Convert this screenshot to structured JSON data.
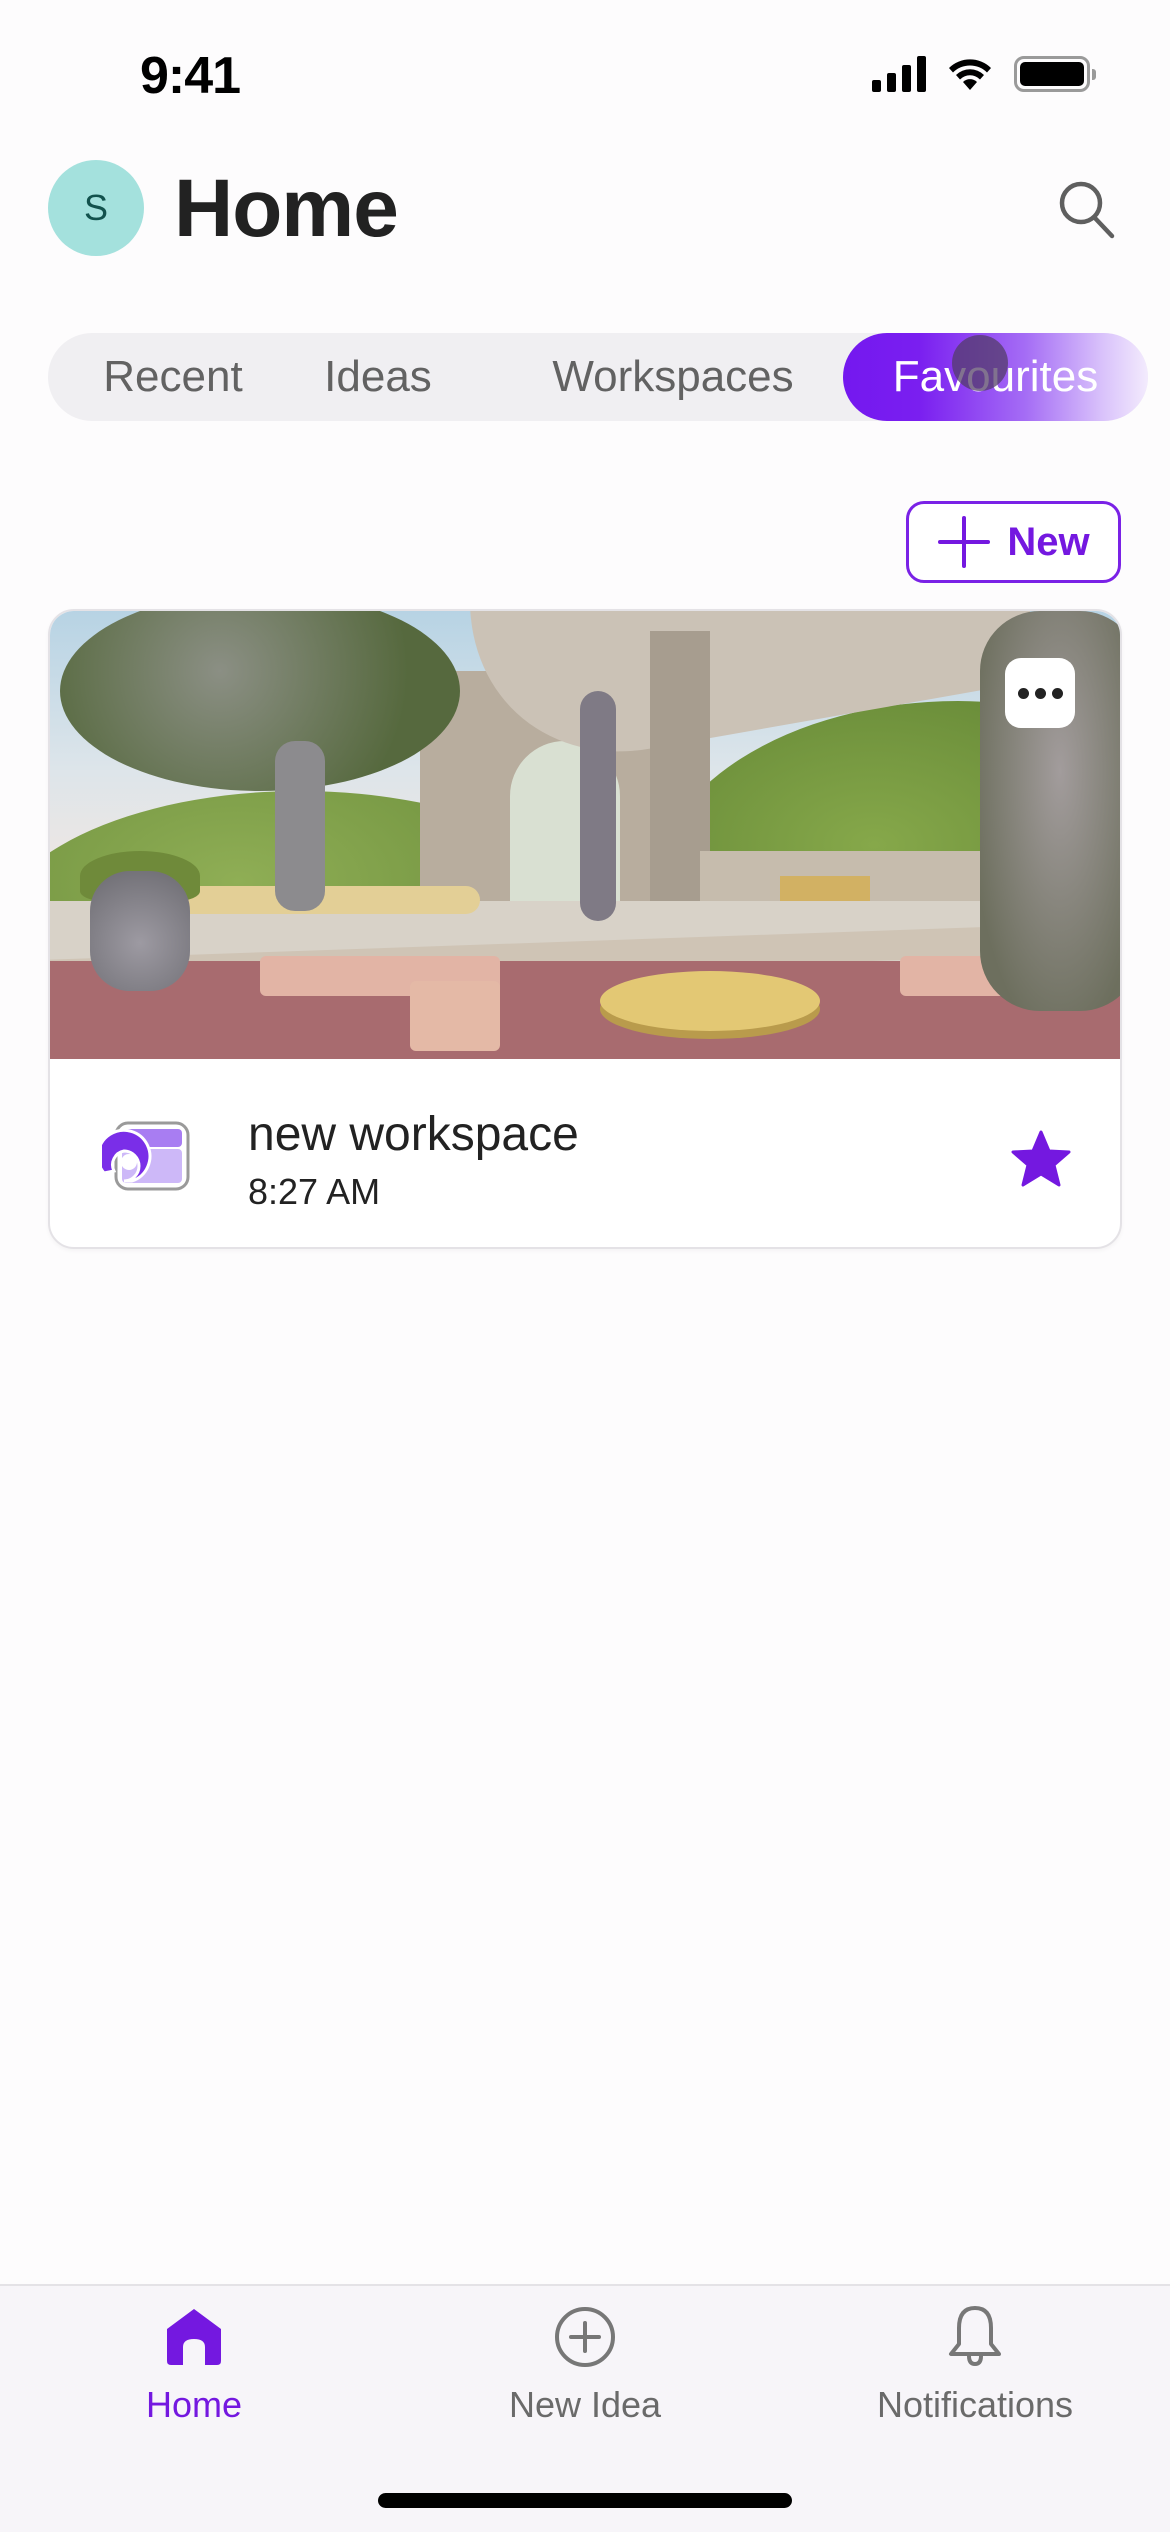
{
  "status_bar": {
    "time": "9:41",
    "icons": [
      "cellular-signal-icon",
      "wifi-icon",
      "battery-icon"
    ]
  },
  "header": {
    "avatar_initial": "S",
    "avatar_color": "#a4e1dd",
    "title": "Home",
    "search_icon": "search-icon"
  },
  "segments": {
    "items": [
      {
        "label": "Recent",
        "selected": false
      },
      {
        "label": "Ideas",
        "selected": false
      },
      {
        "label": "Workspaces",
        "selected": false
      },
      {
        "label": "Favourites",
        "selected": true
      }
    ]
  },
  "actions": {
    "new_label": "New",
    "new_icon": "plus-icon"
  },
  "cards": [
    {
      "title": "new workspace",
      "time": "8:27 AM",
      "type_icon": "workspace-icon",
      "more_icon": "more-horizontal-icon",
      "favourite": true,
      "thumbnail_desc": "3D render of a garden courtyard with arch, trees, pink cushions and round table"
    }
  ],
  "tab_bar": {
    "items": [
      {
        "label": "Home",
        "icon": "home-icon",
        "active": true
      },
      {
        "label": "New Idea",
        "icon": "plus-circle-icon",
        "active": false
      },
      {
        "label": "Notifications",
        "icon": "bell-icon",
        "active": false
      }
    ]
  },
  "colors": {
    "accent": "#7418e0",
    "segment_bg": "#f0eff2",
    "tabbar_bg": "#f7f5f9",
    "inactive_text": "#626262"
  }
}
